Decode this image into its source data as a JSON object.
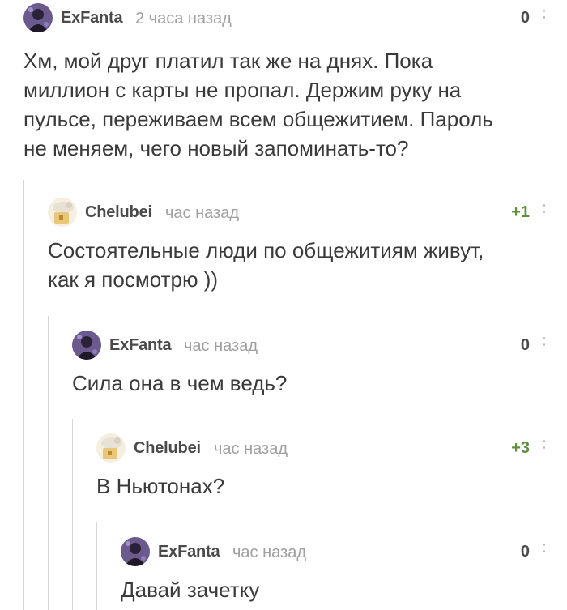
{
  "comments": [
    {
      "author": "ExFanta",
      "time": "2 часа назад",
      "rating": "0",
      "avatar": "exfanta-avatar",
      "text_lines": [
        "Хм, мой друг платил так же на днях. Пока",
        "миллион с карты не пропал. Держим руку на",
        "пульсе, переживаем всем общежитием. Пароль",
        "не меняем, чего новый запоминать-то?"
      ]
    },
    {
      "author": "Chelubei",
      "time": "час назад",
      "rating": "+1",
      "avatar": "chelubei-avatar",
      "text_lines": [
        "Состоятельные люди по общежитиям живут,",
        "как я посмотрю ))"
      ]
    },
    {
      "author": "ExFanta",
      "time": "час назад",
      "rating": "0",
      "avatar": "exfanta-avatar",
      "text_lines": [
        "Сила она в чем ведь?"
      ]
    },
    {
      "author": "Chelubei",
      "time": "час назад",
      "rating": "+3",
      "avatar": "chelubei-avatar",
      "text_lines": [
        "В Ньютонах?"
      ]
    },
    {
      "author": "ExFanta",
      "time": "час назад",
      "rating": "0",
      "avatar": "exfanta-avatar",
      "text_lines": [
        "Давай зачетку"
      ]
    }
  ],
  "colors": {
    "positive_rating": "#5e8e3e",
    "text": "#3a3a3a",
    "muted": "#a0a0a0",
    "thread_line": "#d6d6d6"
  }
}
